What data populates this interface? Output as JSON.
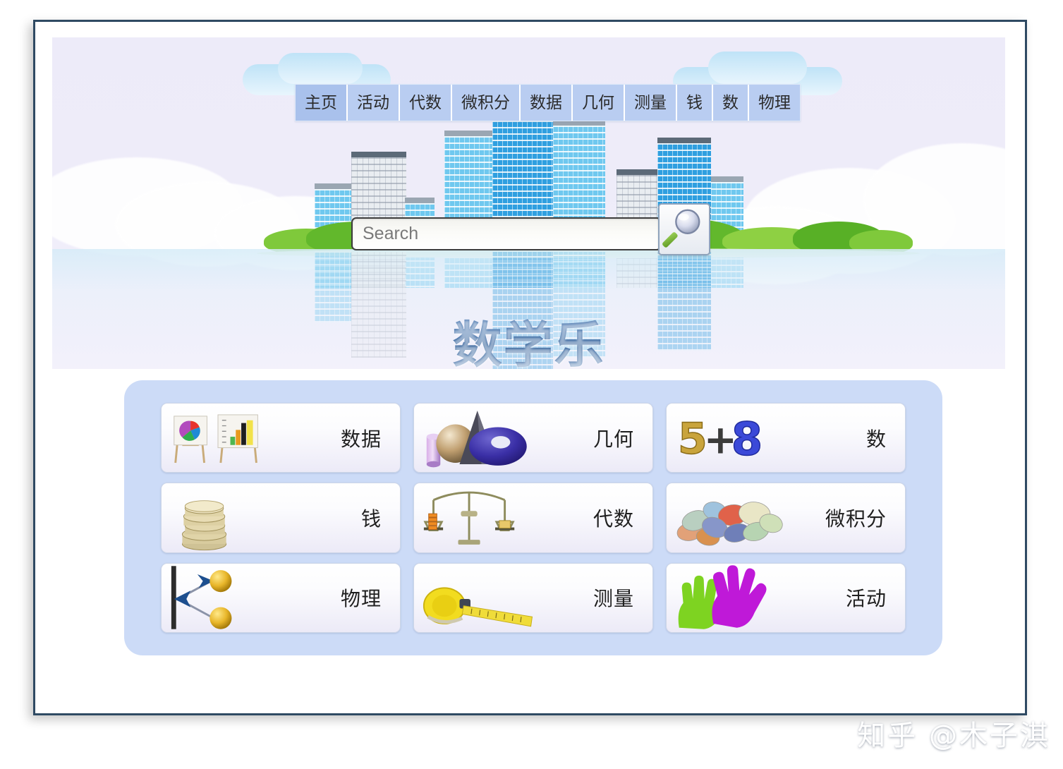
{
  "site": {
    "title": "数学乐",
    "watermark": "知乎 @木子淇"
  },
  "nav": {
    "items": [
      {
        "label": "主页",
        "name": "nav-home",
        "active": true
      },
      {
        "label": "活动",
        "name": "nav-activities",
        "active": false
      },
      {
        "label": "代数",
        "name": "nav-algebra",
        "active": false
      },
      {
        "label": "微积分",
        "name": "nav-calculus",
        "active": false
      },
      {
        "label": "数据",
        "name": "nav-data",
        "active": false
      },
      {
        "label": "几何",
        "name": "nav-geometry",
        "active": false
      },
      {
        "label": "测量",
        "name": "nav-measurement",
        "active": false
      },
      {
        "label": "钱",
        "name": "nav-money",
        "active": false
      },
      {
        "label": "数",
        "name": "nav-numbers",
        "active": false
      },
      {
        "label": "物理",
        "name": "nav-physics",
        "active": false
      }
    ]
  },
  "search": {
    "placeholder": "Search",
    "value": "",
    "button_icon": "magnifier-icon"
  },
  "cards": [
    {
      "label": "数据",
      "icon": "chart-easels-icon",
      "name": "card-data"
    },
    {
      "label": "几何",
      "icon": "solid-shapes-icon",
      "name": "card-geometry"
    },
    {
      "label": "数",
      "icon": "five-plus-eight-icon",
      "name": "card-numbers"
    },
    {
      "label": "钱",
      "icon": "coin-stack-icon",
      "name": "card-money"
    },
    {
      "label": "代数",
      "icon": "balance-scale-icon",
      "name": "card-algebra"
    },
    {
      "label": "微积分",
      "icon": "pebbles-icon",
      "name": "card-calculus"
    },
    {
      "label": "物理",
      "icon": "bouncing-balls-icon",
      "name": "card-physics"
    },
    {
      "label": "测量",
      "icon": "tape-measure-icon",
      "name": "card-measurement"
    },
    {
      "label": "活动",
      "icon": "handprints-icon",
      "name": "card-activities"
    }
  ],
  "colors": {
    "nav_bg": "#b9cdf1",
    "panel_bg": "#ccdbf7",
    "banner_bg": "#edebf9",
    "frame_border": "#2f4a63",
    "title_blue": "#2c5c97"
  }
}
